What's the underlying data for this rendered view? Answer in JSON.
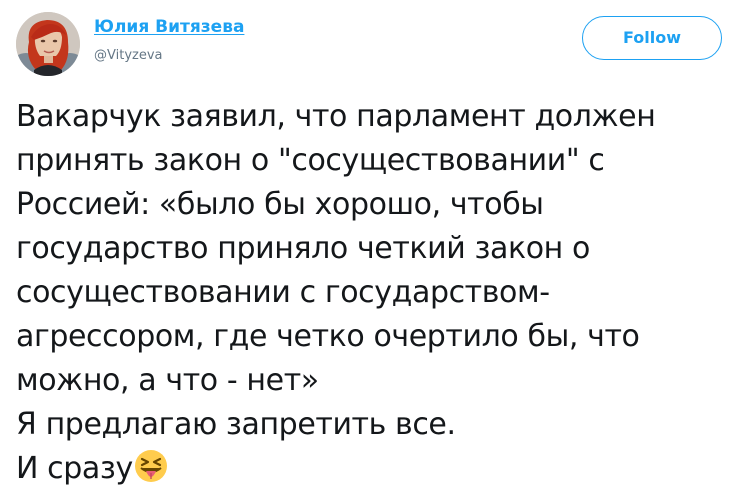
{
  "author": {
    "display_name": "Юлия Витязева",
    "handle": "@Vityzeva",
    "avatar_icon": "user-avatar-photo"
  },
  "actions": {
    "follow_label": "Follow"
  },
  "tweet": {
    "lines": [
      "Вакарчук заявил, что парламент должен",
      "принять закон о \"сосуществовании\" с",
      "Россией: «было бы хорошо, чтобы",
      "государство приняло четкий закон о",
      "сосуществовании с государством-",
      "агрессором, где четко очертило бы, что",
      "можно, а что - нет»",
      "Я предлагаю запретить все.",
      "И сразу"
    ],
    "emoji": "squinting-face-with-tongue-icon"
  },
  "colors": {
    "accent": "#1da1f2",
    "secondary_text": "#657786",
    "text": "#14171a"
  }
}
